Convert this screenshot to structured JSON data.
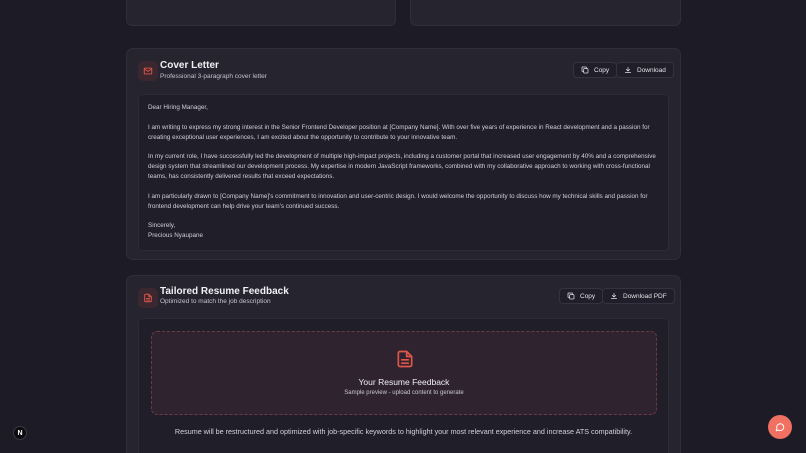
{
  "cover_letter": {
    "icon": "mail-icon",
    "title": "Cover Letter",
    "subtitle": "Professional 3-paragraph cover letter",
    "copy_label": "Copy",
    "download_label": "Download",
    "greeting": "Dear Hiring Manager,",
    "paragraphs": [
      "I am writing to express my strong interest in the Senior Frontend Developer position at [Company Name]. With over five years of experience in React development and a passion for creating exceptional user experiences, I am excited about the opportunity to contribute to your innovative team.",
      "In my current role, I have successfully led the development of multiple high-impact projects, including a customer portal that increased user engagement by 40% and a comprehensive design system that streamlined our development process. My expertise in modern JavaScript frameworks, combined with my collaborative approach to working with cross-functional teams, has consistently delivered results that exceed expectations.",
      "I am particularly drawn to [Company Name]'s commitment to innovation and user-centric design. I would welcome the opportunity to discuss how my technical skills and passion for frontend development can help drive your team's continued success."
    ],
    "closing": "Sincerely,",
    "signature": "Precious Nyaupane"
  },
  "resume_feedback": {
    "icon": "file-text-icon",
    "title": "Tailored Resume Feedback",
    "subtitle": "Optimized to match the job description",
    "copy_label": "Copy",
    "download_label": "Download PDF",
    "preview_title": "Your Resume Feedback",
    "preview_subtitle": "Sample preview - upload content to generate",
    "note": "Resume will be restructured and optimized with job-specific keywords to highlight your most relevant experience and increase ATS compatibility."
  },
  "dev_badge": "N",
  "colors": {
    "background": "#1c1b26",
    "card": "#25242f",
    "accent": "#f07062",
    "accent_icon": "#e0574a"
  }
}
